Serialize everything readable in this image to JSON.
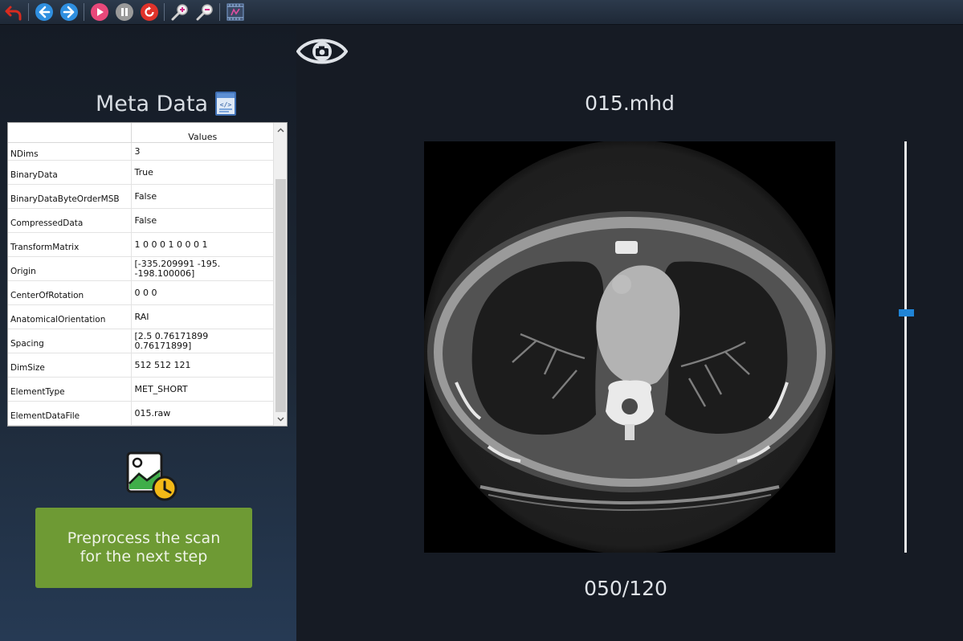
{
  "toolbar": {
    "icons": [
      "undo-icon",
      "back-icon",
      "forward-icon",
      "play-icon",
      "pause-icon",
      "reset-icon",
      "zoom-in-icon",
      "zoom-out-icon",
      "viewer-icon"
    ]
  },
  "meta": {
    "title": "Meta Data",
    "header_values": "Values",
    "rows": [
      {
        "key": "NDims",
        "value": "3"
      },
      {
        "key": "BinaryData",
        "value": "True"
      },
      {
        "key": "BinaryDataByteOrderMSB",
        "value": "False"
      },
      {
        "key": "CompressedData",
        "value": "False"
      },
      {
        "key": "TransformMatrix",
        "value": "1 0 0 0 1 0 0 0 1"
      },
      {
        "key": "Origin",
        "value": "[-335.209991 -195.\n-198.100006]"
      },
      {
        "key": "CenterOfRotation",
        "value": "0 0 0"
      },
      {
        "key": "AnatomicalOrientation",
        "value": "RAI"
      },
      {
        "key": "Spacing",
        "value": "[2.5         0.76171899\n0.76171899]"
      },
      {
        "key": "DimSize",
        "value": "512 512 121"
      },
      {
        "key": "ElementType",
        "value": "MET_SHORT"
      },
      {
        "key": "ElementDataFile",
        "value": "015.raw"
      }
    ]
  },
  "preprocess": {
    "label": "Preprocess the scan\nfor the next step"
  },
  "viewer": {
    "file_name": "015.mhd",
    "current_slice": 50,
    "total_slices": 120,
    "slice_counter": "050/120"
  },
  "colors": {
    "accent_blue": "#1f84d6",
    "button_green": "#6e9a34"
  }
}
